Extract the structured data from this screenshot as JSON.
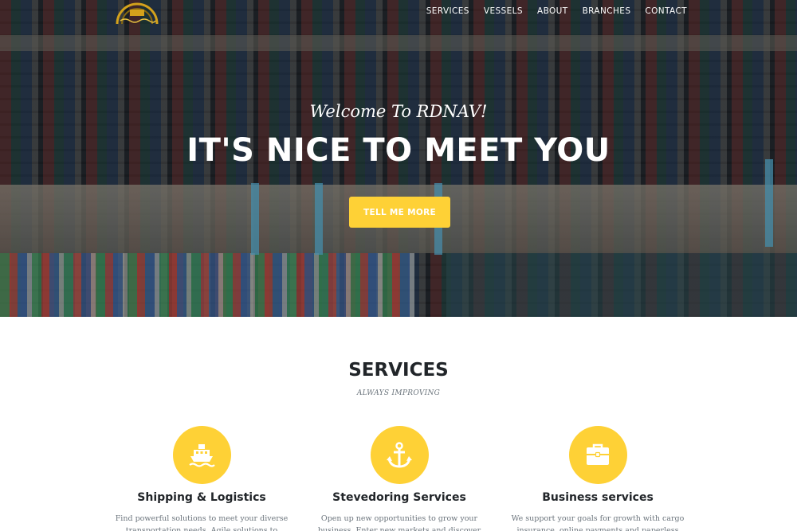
{
  "nav": {
    "logo_alt": "RDNAV logo",
    "items": [
      "SERVICES",
      "VESSELS",
      "ABOUT",
      "BRANCHES",
      "CONTACT"
    ]
  },
  "hero": {
    "subheading": "Welcome To RDNAV!",
    "heading": "IT'S NICE TO MEET YOU",
    "button_label": "TELL ME MORE"
  },
  "services": {
    "heading": "SERVICES",
    "subheading": "ALWAYS IMPROVING",
    "items": [
      {
        "title": "Shipping & Logistics",
        "icon": "ship-icon",
        "text": "Find powerful solutions to meet your diverse transportation needs. Agile solutions to handle all your"
      },
      {
        "title": "Stevedoring Services",
        "icon": "anchor-icon",
        "text": "Open up new opportunities to grow your business. Enter new markets and discover new continents. We"
      },
      {
        "title": "Business services",
        "icon": "briefcase-icon",
        "text": "We support your goals for growth with cargo insurance, online payments and paperless workflow"
      }
    ]
  },
  "colors": {
    "accent": "#fed136",
    "heading": "#212529",
    "muted": "#6c757d"
  }
}
